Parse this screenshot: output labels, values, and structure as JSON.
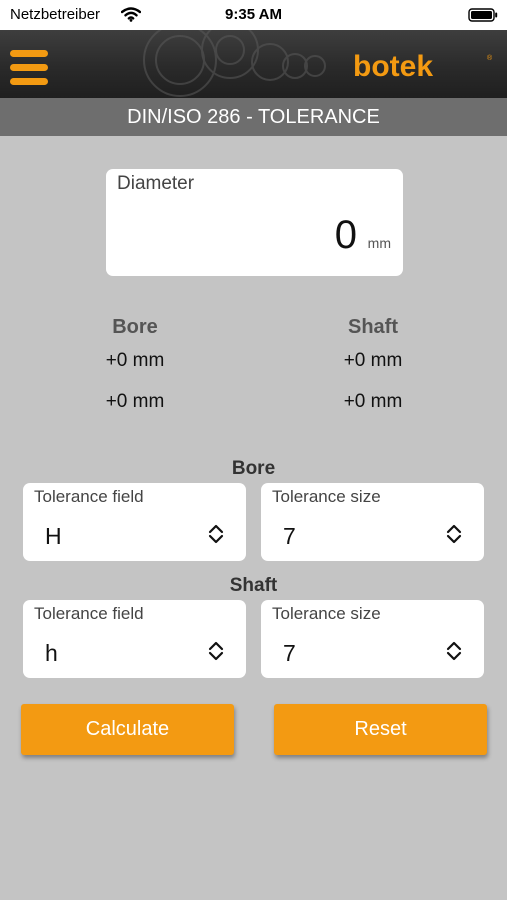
{
  "status": {
    "carrier": "Netzbetreiber",
    "time": "9:35 AM"
  },
  "header": {
    "brand": "botek",
    "title": "DIN/ISO 286 - TOLERANCE"
  },
  "colors": {
    "accent": "#f39a12",
    "header_bg": "#2a2a2a",
    "title_bg": "#6e6e6e",
    "page_bg": "#c4c4c4"
  },
  "diameter": {
    "label": "Diameter",
    "value": "0",
    "unit": "mm"
  },
  "results": {
    "bore": {
      "heading": "Bore",
      "upper": "+0 mm",
      "lower": "+0 mm"
    },
    "shaft": {
      "heading": "Shaft",
      "upper": "+0 mm",
      "lower": "+0 mm"
    }
  },
  "bore": {
    "section_label": "Bore",
    "field": {
      "label": "Tolerance field",
      "value": "H"
    },
    "size": {
      "label": "Tolerance size",
      "value": "7"
    }
  },
  "shaft": {
    "section_label": "Shaft",
    "field": {
      "label": "Tolerance field",
      "value": "h"
    },
    "size": {
      "label": "Tolerance size",
      "value": "7"
    }
  },
  "actions": {
    "calculate": "Calculate",
    "reset": "Reset"
  },
  "icons": [
    "wifi-icon",
    "battery-icon",
    "menu-icon",
    "chevron-up-down-icon"
  ]
}
